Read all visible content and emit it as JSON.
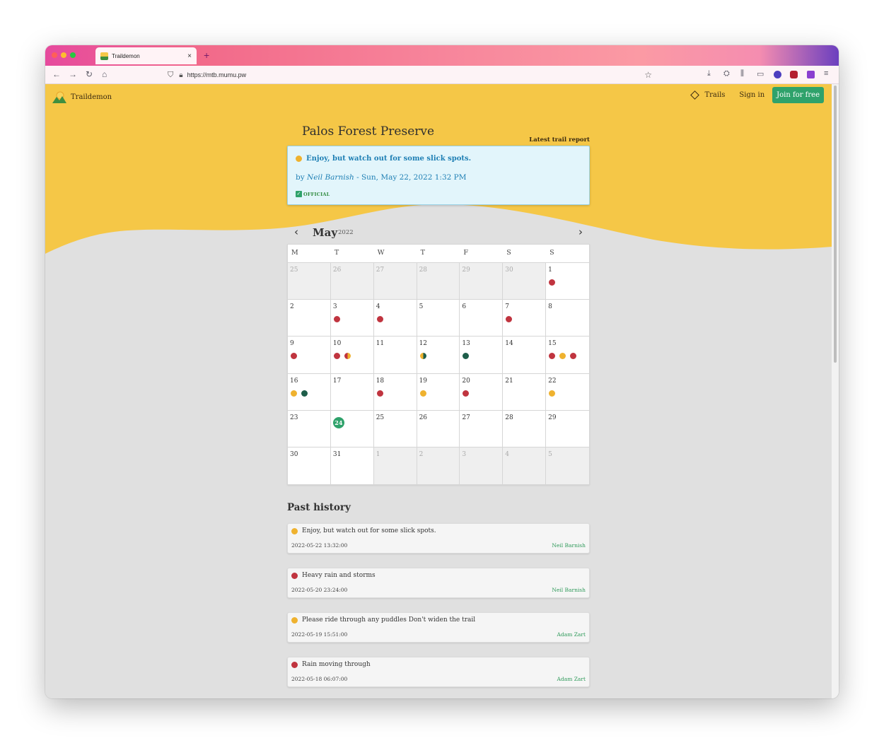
{
  "browser": {
    "tab_title": "Traildemon",
    "tab_close": "×",
    "new_tab": "+",
    "url": "https://mtb.mumu.pw"
  },
  "site": {
    "brand": "Traildemon",
    "nav_trails": "Trails",
    "nav_signin": "Sign in",
    "nav_join": "Join for free"
  },
  "trail": {
    "title": "Palos Forest Preserve",
    "latest_label": "Latest trail report",
    "latest": {
      "status": "Enjoy, but watch out for some slick spots.",
      "by": "by",
      "author": "Neil Barnish",
      "date": " - Sun, May 22, 2022 1:32 PM",
      "official": "OFFICIAL"
    }
  },
  "calendar": {
    "prev": "‹",
    "next": "›",
    "month": "May",
    "year": "2022",
    "weekdays": [
      "M",
      "T",
      "W",
      "T",
      "F",
      "S",
      "S"
    ],
    "weeks": [
      [
        {
          "n": "25",
          "out": true
        },
        {
          "n": "26",
          "out": true
        },
        {
          "n": "27",
          "out": true
        },
        {
          "n": "28",
          "out": true
        },
        {
          "n": "29",
          "out": true
        },
        {
          "n": "30",
          "out": true
        },
        {
          "n": "1",
          "dots": [
            "red"
          ]
        }
      ],
      [
        {
          "n": "2"
        },
        {
          "n": "3",
          "dots": [
            "red"
          ]
        },
        {
          "n": "4",
          "dots": [
            "red"
          ]
        },
        {
          "n": "5"
        },
        {
          "n": "6"
        },
        {
          "n": "7",
          "dots": [
            "red"
          ]
        },
        {
          "n": "8"
        }
      ],
      [
        {
          "n": "9",
          "dots": [
            "red"
          ]
        },
        {
          "n": "10",
          "dots": [
            "red",
            "red-yellow"
          ]
        },
        {
          "n": "11"
        },
        {
          "n": "12",
          "dots": [
            "yellow-green"
          ]
        },
        {
          "n": "13",
          "dots": [
            "green"
          ]
        },
        {
          "n": "14"
        },
        {
          "n": "15",
          "dots": [
            "red",
            "yellow",
            "red"
          ]
        }
      ],
      [
        {
          "n": "16",
          "dots": [
            "yellow",
            "green"
          ]
        },
        {
          "n": "17"
        },
        {
          "n": "18",
          "dots": [
            "red"
          ]
        },
        {
          "n": "19",
          "dots": [
            "yellow"
          ]
        },
        {
          "n": "20",
          "dots": [
            "red"
          ]
        },
        {
          "n": "21"
        },
        {
          "n": "22",
          "dots": [
            "yellow"
          ]
        }
      ],
      [
        {
          "n": "23"
        },
        {
          "n": "24",
          "today": true
        },
        {
          "n": "25"
        },
        {
          "n": "26"
        },
        {
          "n": "27"
        },
        {
          "n": "28"
        },
        {
          "n": "29"
        }
      ],
      [
        {
          "n": "30"
        },
        {
          "n": "31"
        },
        {
          "n": "1",
          "out": true
        },
        {
          "n": "2",
          "out": true
        },
        {
          "n": "3",
          "out": true
        },
        {
          "n": "4",
          "out": true
        },
        {
          "n": "5",
          "out": true
        }
      ]
    ]
  },
  "history": {
    "title": "Past history",
    "items": [
      {
        "status": "Enjoy, but watch out for some slick spots.",
        "color": "yellow",
        "time": "2022-05-22 13:32:00",
        "author": "Neil Barnish"
      },
      {
        "status": "Heavy rain and storms",
        "color": "red",
        "time": "2022-05-20 23:24:00",
        "author": "Neil Barnish"
      },
      {
        "status": "Please ride through any puddles Don't widen the trail",
        "color": "yellow",
        "time": "2022-05-19 15:51:00",
        "author": "Adam Zart"
      },
      {
        "status": "Rain moving through",
        "color": "red",
        "time": "2022-05-18 06:07:00",
        "author": "Adam Zart"
      }
    ]
  },
  "colors": {
    "brand_yellow": "#f5c747",
    "status_red": "#c0343f",
    "status_yellow": "#efb22f",
    "status_green": "#1e5e4a",
    "join_green": "#2fa26b"
  }
}
